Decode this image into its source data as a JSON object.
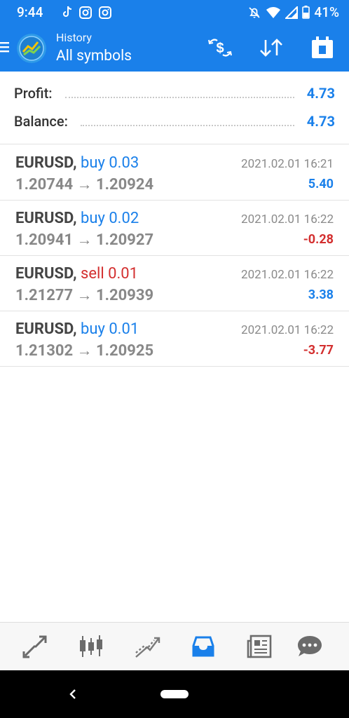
{
  "status_bar": {
    "time": "9:44",
    "battery": "41%",
    "icons": [
      "tiktok-icon",
      "instagram-icon",
      "instagram-icon",
      "bell-off-icon",
      "wifi-icon",
      "signal-icon",
      "battery-icon"
    ]
  },
  "app_bar": {
    "subtitle": "History",
    "title": "All symbols",
    "actions": [
      "exchange-dollar-icon",
      "sort-icon",
      "calendar-icon"
    ]
  },
  "summary": {
    "profit_label": "Profit:",
    "profit_value": "4.73",
    "balance_label": "Balance:",
    "balance_value": "4.73"
  },
  "deals": [
    {
      "symbol": "EURUSD,",
      "type": "buy 0.03",
      "prices": "1.20744 → 1.20924",
      "time": "2021.02.01 16:21",
      "profit": "5.40",
      "profit_sign": "pos"
    },
    {
      "symbol": "EURUSD,",
      "type": "buy 0.02",
      "prices": "1.20941 → 1.20927",
      "time": "2021.02.01 16:22",
      "profit": "-0.28",
      "profit_sign": "neg"
    },
    {
      "symbol": "EURUSD,",
      "type": "sell 0.01",
      "prices": "1.21277 → 1.20939",
      "time": "2021.02.01 16:22",
      "profit": "3.38",
      "profit_sign": "pos"
    },
    {
      "symbol": "EURUSD,",
      "type": "buy 0.01",
      "prices": "1.21302 → 1.20925",
      "time": "2021.02.01 16:22",
      "profit": "-3.77",
      "profit_sign": "neg"
    }
  ],
  "bottom_nav": [
    "quotes-icon",
    "chart-icon",
    "trade-icon",
    "history-icon",
    "news-icon",
    "messages-icon"
  ],
  "colors": {
    "brand": "#1a80ea",
    "negative": "#d32f2f",
    "active_tab": "#1a80ea"
  }
}
